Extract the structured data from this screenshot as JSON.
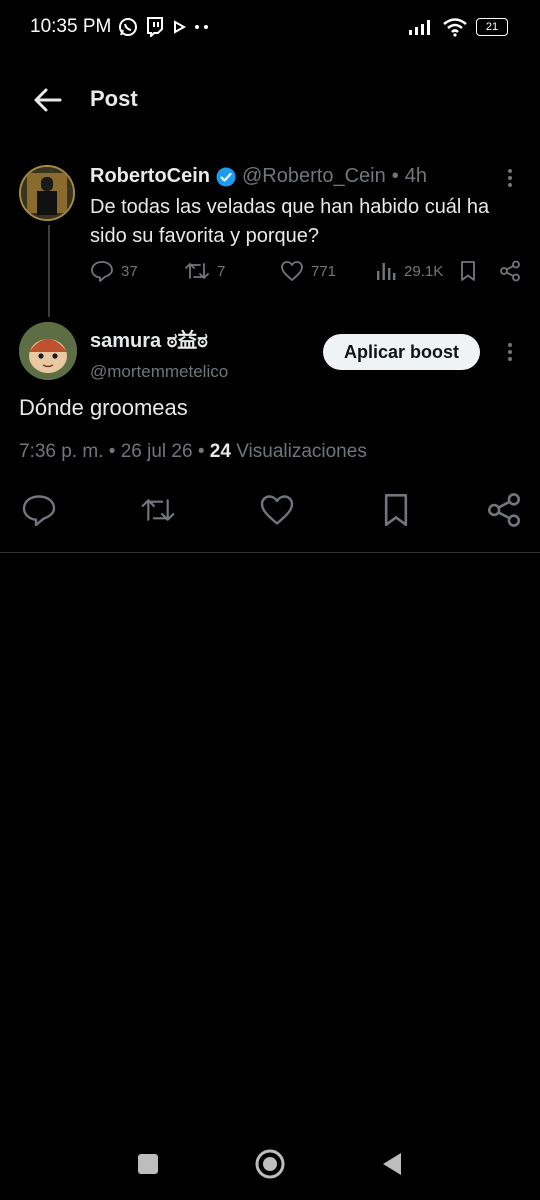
{
  "status": {
    "time": "10:35 PM",
    "battery": "21",
    "left_icons": [
      "whatsapp-icon",
      "twitch-icon",
      "play-icon",
      "more-dots-icon"
    ],
    "right_icons": [
      "signal-icon",
      "wifi-icon",
      "battery-icon"
    ]
  },
  "header": {
    "title": "Post"
  },
  "parent_tweet": {
    "display_name": "RobertoCein",
    "handle": "@Roberto_Cein",
    "separator": "•",
    "time": "4h",
    "text": "De todas las veladas que han habido cuál ha sido su favorita y porque?",
    "replies": "37",
    "reposts": "7",
    "likes": "771",
    "views": "29.1K",
    "verified_color": "#1d9bf0"
  },
  "main_tweet": {
    "display_name": "samura ಠ益ಠ",
    "handle": "@mortemmetelico",
    "boost_label": "Aplicar boost",
    "text": "Dónde groomeas",
    "time": "7:36 p. m.",
    "date": "26 jul 26",
    "views_count": "24",
    "views_label": "Visualizaciones",
    "dot": "•"
  },
  "colors": {
    "accent": "#1d9bf0",
    "muted": "#71767b",
    "text": "#e7e9ea",
    "background": "#000000"
  }
}
